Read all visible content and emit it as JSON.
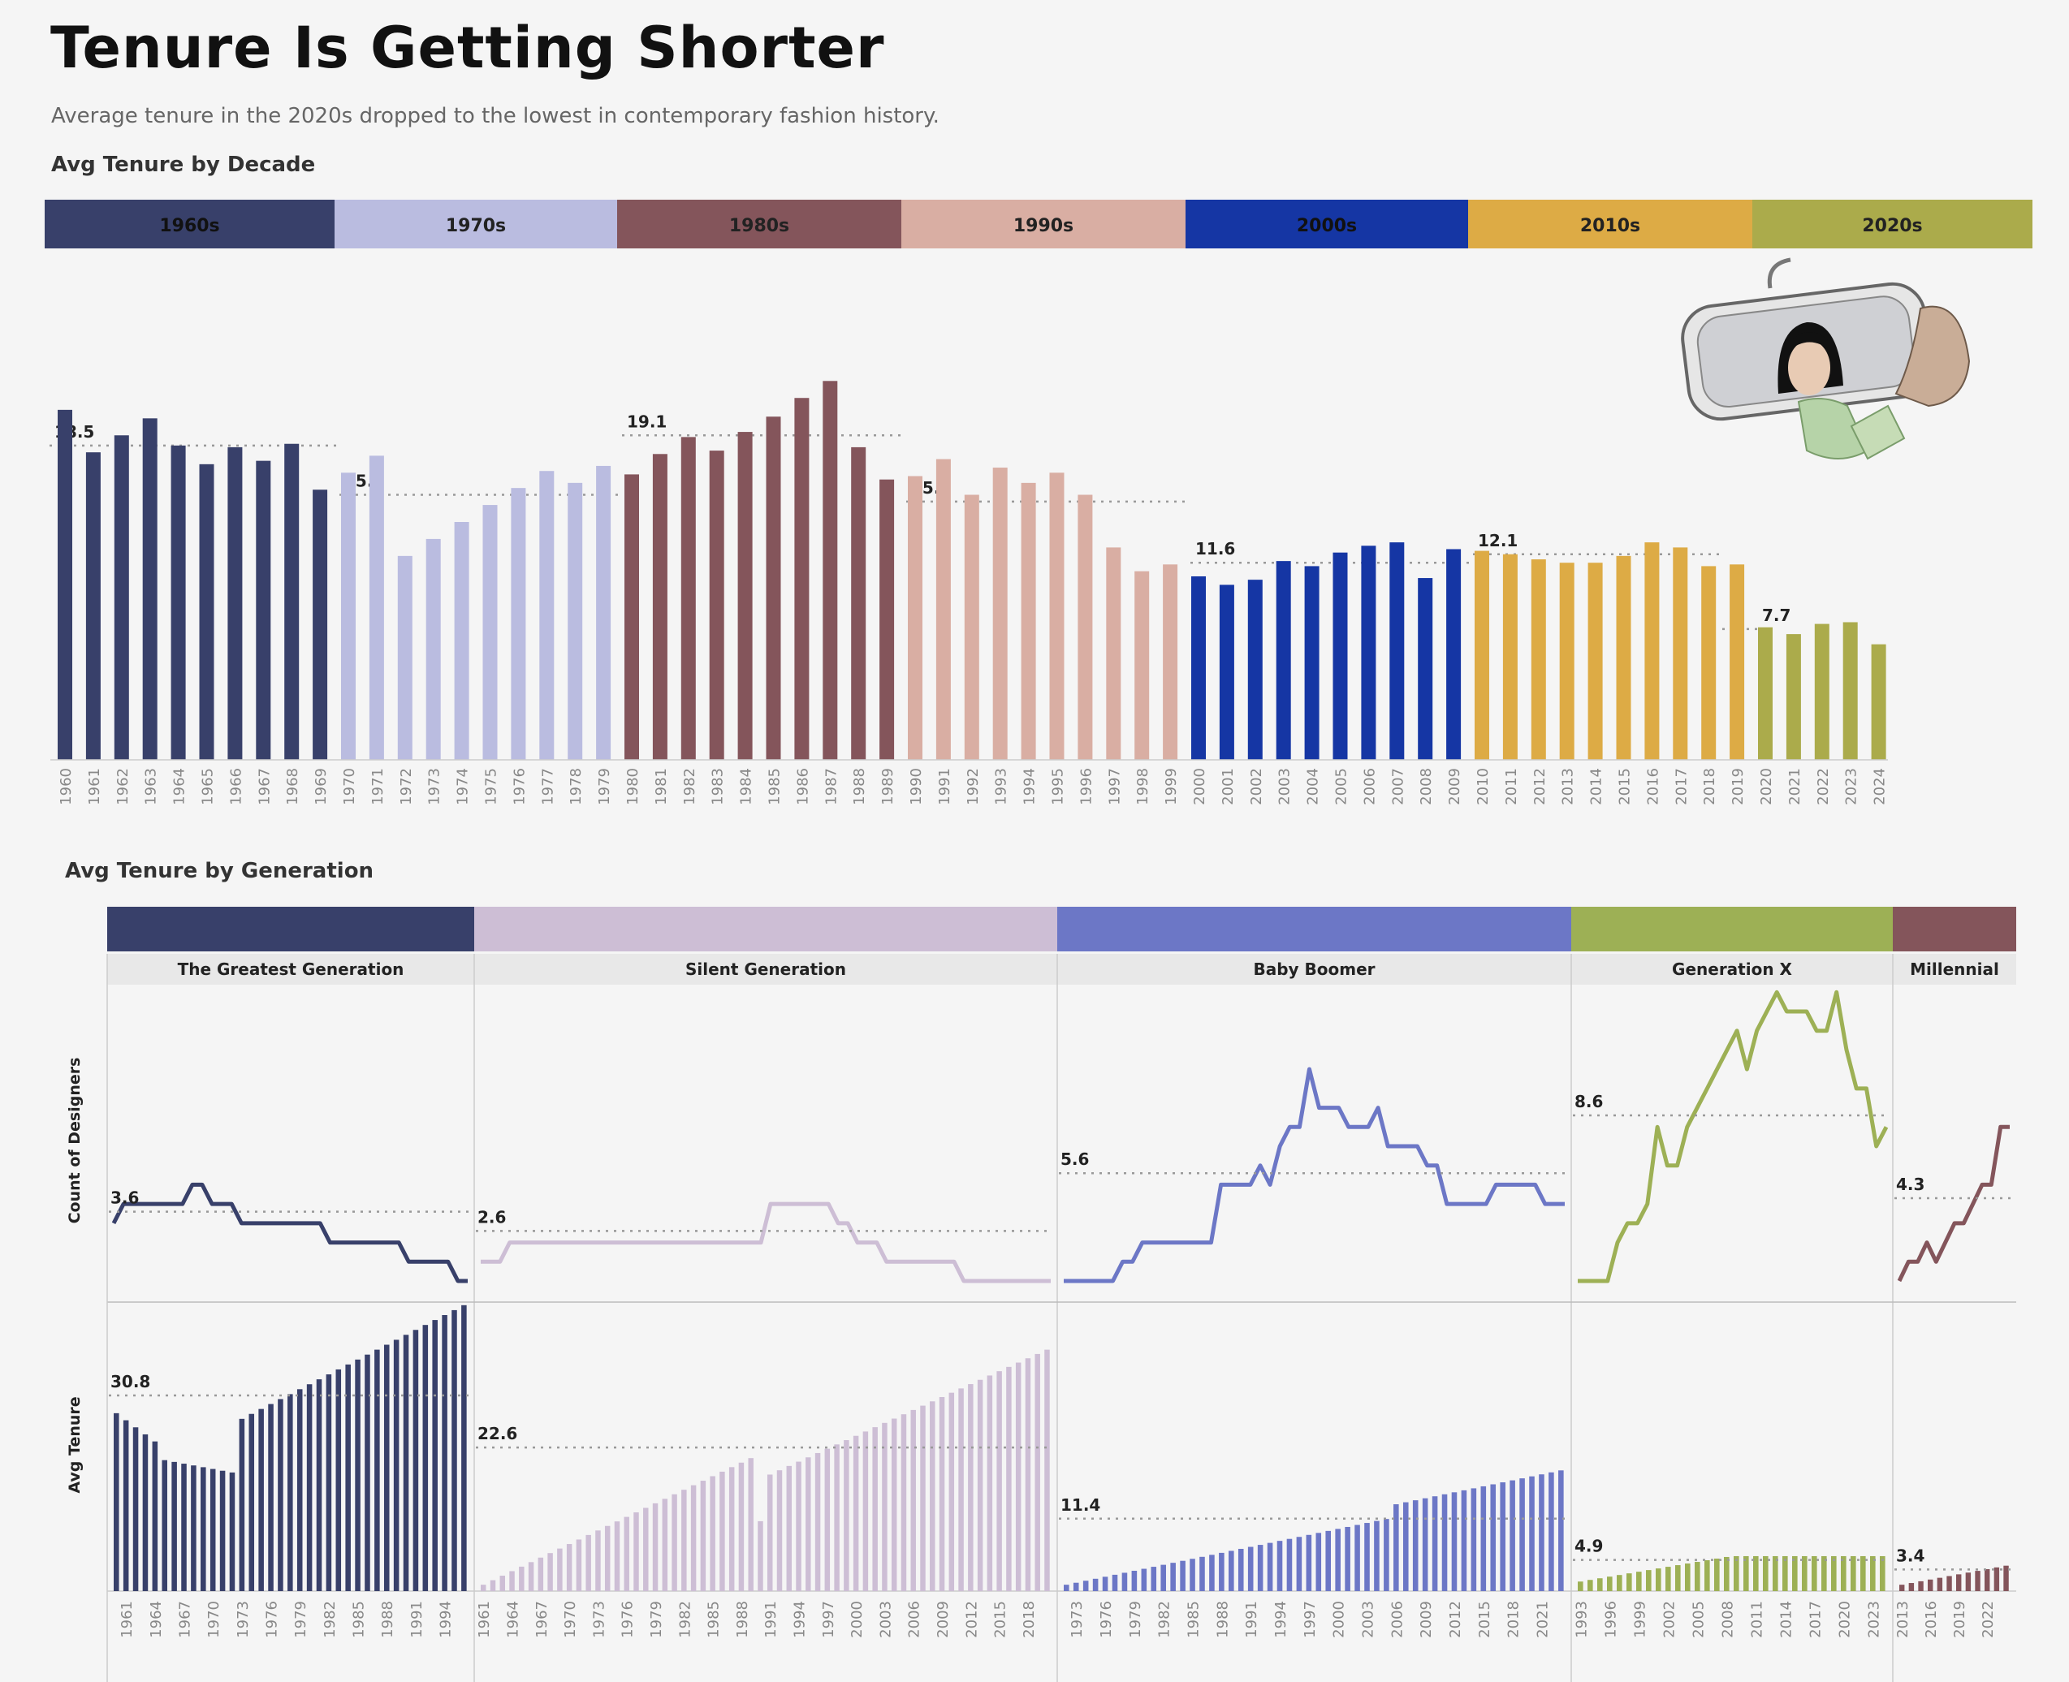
{
  "title": "Tenure Is Getting Shorter",
  "subtitle": "Average tenure in the 2020s dropped to the lowest in contemporary fashion history.",
  "decade_section_title": "Avg Tenure by Decade",
  "generation_section_title": "Avg Tenure by Generation",
  "count_axis_label": "Count of Designers",
  "tenure_axis_label": "Avg Tenure",
  "illustration": "rearview-mirror-illustration",
  "chart_data": [
    {
      "type": "bar",
      "title": "Avg Tenure by Decade",
      "ylim": [
        0,
        28
      ],
      "decades": [
        {
          "label": "1960s",
          "color": "#38406a",
          "avg": 18.5,
          "years": [
            1960,
            1961,
            1962,
            1963,
            1964,
            1965,
            1966,
            1967,
            1968,
            1969
          ],
          "values": [
            20.6,
            18.1,
            19.1,
            20.1,
            18.5,
            17.4,
            18.4,
            17.6,
            18.6,
            15.9
          ]
        },
        {
          "label": "1970s",
          "color": "#babce0",
          "avg": 15.6,
          "years": [
            1970,
            1971,
            1972,
            1973,
            1974,
            1975,
            1976,
            1977,
            1978,
            1979
          ],
          "values": [
            16.9,
            17.9,
            12.0,
            13.0,
            14.0,
            15.0,
            16.0,
            17.0,
            16.3,
            17.3
          ]
        },
        {
          "label": "1980s",
          "color": "#84555b",
          "avg": 19.1,
          "years": [
            1980,
            1981,
            1982,
            1983,
            1984,
            1985,
            1986,
            1987,
            1988,
            1989
          ],
          "values": [
            16.8,
            18.0,
            19.0,
            18.2,
            19.3,
            20.2,
            21.3,
            22.3,
            18.4,
            16.5
          ]
        },
        {
          "label": "1990s",
          "color": "#d9aea3",
          "avg": 15.2,
          "years": [
            1990,
            1991,
            1992,
            1993,
            1994,
            1995,
            1996,
            1997,
            1998,
            1999
          ],
          "values": [
            16.7,
            17.7,
            15.6,
            17.2,
            16.3,
            16.9,
            15.6,
            12.5,
            11.1,
            11.5
          ]
        },
        {
          "label": "2000s",
          "color": "#1536a4",
          "avg": 11.6,
          "years": [
            2000,
            2001,
            2002,
            2003,
            2004,
            2005,
            2006,
            2007,
            2008,
            2009
          ],
          "values": [
            10.8,
            10.3,
            10.6,
            11.7,
            11.4,
            12.2,
            12.6,
            12.8,
            10.7,
            12.4
          ]
        },
        {
          "label": "2010s",
          "color": "#ddab45",
          "avg": 12.1,
          "years": [
            2010,
            2011,
            2012,
            2013,
            2014,
            2015,
            2016,
            2017,
            2018,
            2019
          ],
          "values": [
            12.3,
            12.1,
            11.8,
            11.6,
            11.6,
            12.0,
            12.8,
            12.5,
            11.4,
            11.5
          ]
        },
        {
          "label": "2020s",
          "color": "#abab4b",
          "avg": 7.7,
          "years": [
            2020,
            2021,
            2022,
            2023,
            2024
          ],
          "values": [
            7.8,
            7.4,
            8.0,
            8.1,
            6.8
          ]
        }
      ]
    },
    {
      "type": "line",
      "title": "Count of Designers",
      "ylabel": "Count of Designers",
      "ylim": [
        0,
        14
      ],
      "generations": [
        {
          "name": "The Greatest Generation",
          "color": "#38406a",
          "avg": 3.6,
          "years": [
            1960,
            1961,
            1962,
            1963,
            1964,
            1965,
            1966,
            1967,
            1968,
            1969,
            1970,
            1971,
            1972,
            1973,
            1974,
            1975,
            1976,
            1977,
            1978,
            1979,
            1980,
            1981,
            1982,
            1983,
            1984,
            1985,
            1986,
            1987,
            1988,
            1989,
            1990,
            1991,
            1992,
            1993,
            1994,
            1995,
            1996
          ],
          "values": [
            3,
            4,
            4,
            4,
            4,
            4,
            4,
            4,
            5,
            5,
            4,
            4,
            4,
            3,
            3,
            3,
            3,
            3,
            3,
            3,
            3,
            3,
            2,
            2,
            2,
            2,
            2,
            2,
            2,
            2,
            1,
            1,
            1,
            1,
            1,
            0,
            0
          ]
        },
        {
          "name": "Silent Generation",
          "color": "#cdbed5",
          "avg": 2.6,
          "years": [
            1960,
            1961,
            1962,
            1963,
            1964,
            1965,
            1966,
            1967,
            1968,
            1969,
            1970,
            1971,
            1972,
            1973,
            1974,
            1975,
            1976,
            1977,
            1978,
            1979,
            1980,
            1981,
            1982,
            1983,
            1984,
            1985,
            1986,
            1987,
            1988,
            1989,
            1990,
            1991,
            1992,
            1993,
            1994,
            1995,
            1996,
            1997,
            1998,
            1999,
            2000,
            2001,
            2002,
            2003,
            2004,
            2005,
            2006,
            2007,
            2008,
            2009,
            2010,
            2011,
            2012,
            2013,
            2014,
            2015,
            2016,
            2017,
            2018,
            2019
          ],
          "values": [
            1,
            1,
            1,
            2,
            2,
            2,
            2,
            2,
            2,
            2,
            2,
            2,
            2,
            2,
            2,
            2,
            2,
            2,
            2,
            2,
            2,
            2,
            2,
            2,
            2,
            2,
            2,
            2,
            2,
            2,
            4,
            4,
            4,
            4,
            4,
            4,
            4,
            3,
            3,
            2,
            2,
            2,
            1,
            1,
            1,
            1,
            1,
            1,
            1,
            1,
            0,
            0,
            0,
            0,
            0,
            0,
            0,
            0,
            0,
            0
          ]
        },
        {
          "name": "Baby Boomer",
          "color": "#6c77c6",
          "avg": 5.6,
          "years": [
            1972,
            1973,
            1974,
            1975,
            1976,
            1977,
            1978,
            1979,
            1980,
            1981,
            1982,
            1983,
            1984,
            1985,
            1986,
            1987,
            1988,
            1989,
            1990,
            1991,
            1992,
            1993,
            1994,
            1995,
            1996,
            1997,
            1998,
            1999,
            2000,
            2001,
            2002,
            2003,
            2004,
            2005,
            2006,
            2007,
            2008,
            2009,
            2010,
            2011,
            2012,
            2013,
            2014,
            2015,
            2016,
            2017,
            2018,
            2019,
            2020,
            2021,
            2022,
            2023
          ],
          "values": [
            0,
            0,
            0,
            0,
            0,
            0,
            1,
            1,
            2,
            2,
            2,
            2,
            2,
            2,
            2,
            2,
            5,
            5,
            5,
            5,
            6,
            5,
            7,
            8,
            8,
            11,
            9,
            9,
            9,
            8,
            8,
            8,
            9,
            7,
            7,
            7,
            7,
            6,
            6,
            4,
            4,
            4,
            4,
            4,
            5,
            5,
            5,
            5,
            5,
            4,
            4,
            4
          ]
        },
        {
          "name": "Generation X",
          "color": "#9db055",
          "avg": 8.6,
          "years": [
            1993,
            1994,
            1995,
            1996,
            1997,
            1998,
            1999,
            2000,
            2001,
            2002,
            2003,
            2004,
            2005,
            2006,
            2007,
            2008,
            2009,
            2010,
            2011,
            2012,
            2013,
            2014,
            2015,
            2016,
            2017,
            2018,
            2019,
            2020,
            2021,
            2022,
            2023,
            2024
          ],
          "values": [
            0,
            0,
            0,
            0,
            2,
            3,
            3,
            4,
            8,
            6,
            6,
            8,
            9,
            10,
            11,
            12,
            13,
            11,
            13,
            14,
            15,
            14,
            14,
            14,
            13,
            13,
            15,
            12,
            10,
            10,
            7,
            8
          ]
        },
        {
          "name": "Millennial",
          "color": "#84555b",
          "avg": 4.3,
          "years": [
            2012,
            2013,
            2014,
            2015,
            2016,
            2017,
            2018,
            2019,
            2020,
            2021,
            2022,
            2023,
            2024
          ],
          "values": [
            0,
            1,
            1,
            2,
            1,
            2,
            3,
            3,
            4,
            5,
            5,
            8,
            8
          ]
        }
      ]
    },
    {
      "type": "bar",
      "title": "Avg Tenure",
      "ylabel": "Avg Tenure",
      "ylim": [
        0,
        46
      ],
      "generations": [
        {
          "name": "The Greatest Generation",
          "color": "#38406a",
          "avg": 30.8,
          "tick_labels": [
            "1961",
            "1964",
            "1967",
            "1970",
            "1973",
            "1976",
            "1979",
            "1982",
            "1985",
            "1988",
            "1991",
            "1994"
          ]
        },
        {
          "name": "Silent Generation",
          "color": "#cdbed5",
          "avg": 22.6,
          "tick_labels": [
            "1961",
            "1964",
            "1967",
            "1970",
            "1973",
            "1976",
            "1979",
            "1982",
            "1985",
            "1988",
            "1991",
            "1994",
            "1997",
            "2000",
            "2003",
            "2006",
            "2009",
            "2012",
            "2015",
            "2018"
          ]
        },
        {
          "name": "Baby Boomer",
          "color": "#6c77c6",
          "avg": 11.4,
          "tick_labels": [
            "1973",
            "1976",
            "1979",
            "1982",
            "1985",
            "1988",
            "1991",
            "1994",
            "1997",
            "2000",
            "2003",
            "2006",
            "2009",
            "2012",
            "2015",
            "2018",
            "2021"
          ]
        },
        {
          "name": "Generation X",
          "color": "#9db055",
          "avg": 4.9,
          "tick_labels": [
            "1993",
            "1996",
            "1999",
            "2002",
            "2005",
            "2008",
            "2011",
            "2014",
            "2017",
            "2020",
            "2023"
          ]
        },
        {
          "name": "Millennial",
          "color": "#84555b",
          "avg": 3.4,
          "tick_labels": [
            "2013",
            "2016",
            "2019",
            "2022"
          ]
        }
      ]
    }
  ]
}
